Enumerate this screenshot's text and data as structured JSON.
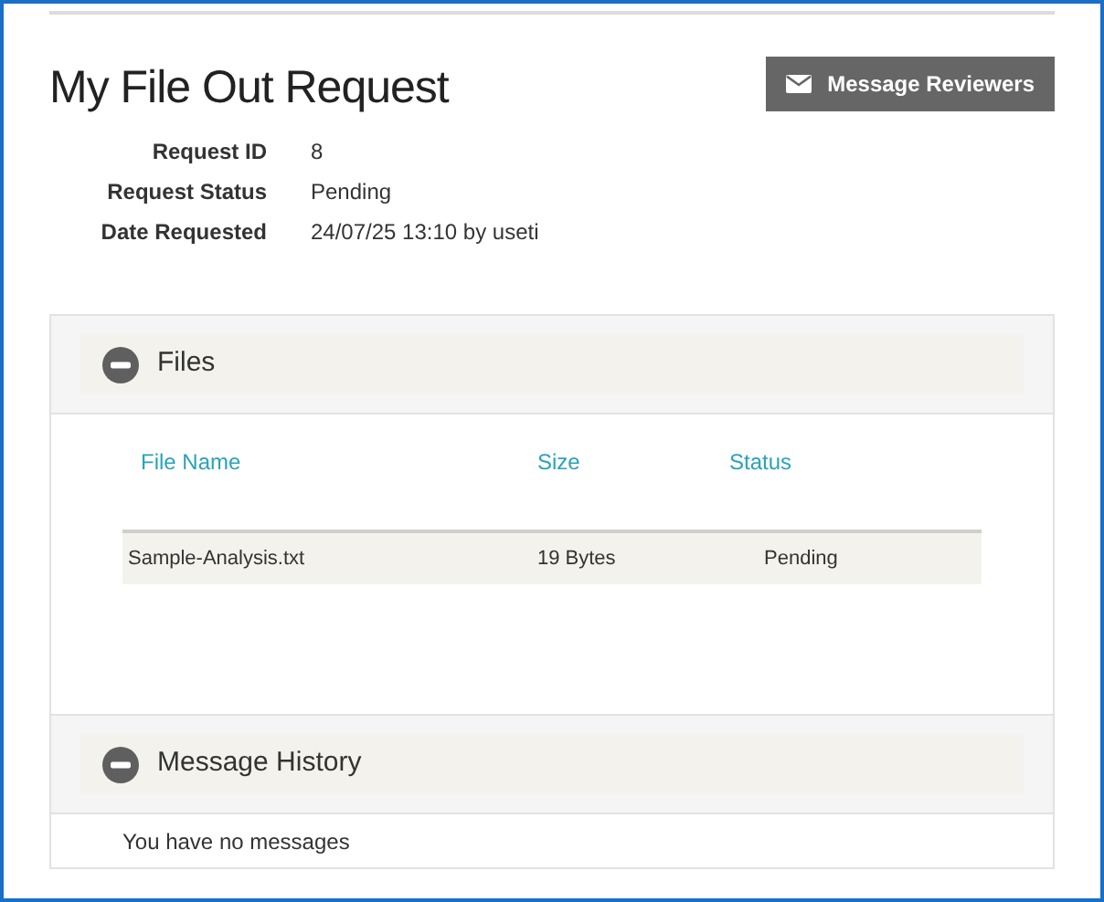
{
  "title": "My File Out Request",
  "action_button": {
    "label": "Message Reviewers"
  },
  "details": [
    {
      "label": "Request ID",
      "value": "8"
    },
    {
      "label": "Request Status",
      "value": "Pending"
    },
    {
      "label": "Date Requested",
      "value": "24/07/25 13:10 by useti"
    }
  ],
  "files_section": {
    "title": "Files",
    "expanded": true,
    "table": {
      "columns": [
        "File Name",
        "Size",
        "Status"
      ],
      "rows": [
        [
          "Sample-Analysis.txt",
          "19 Bytes",
          "Pending"
        ]
      ]
    }
  },
  "messages_section": {
    "title": "Message History",
    "expanded": true,
    "empty_text": "You have no messages"
  }
}
